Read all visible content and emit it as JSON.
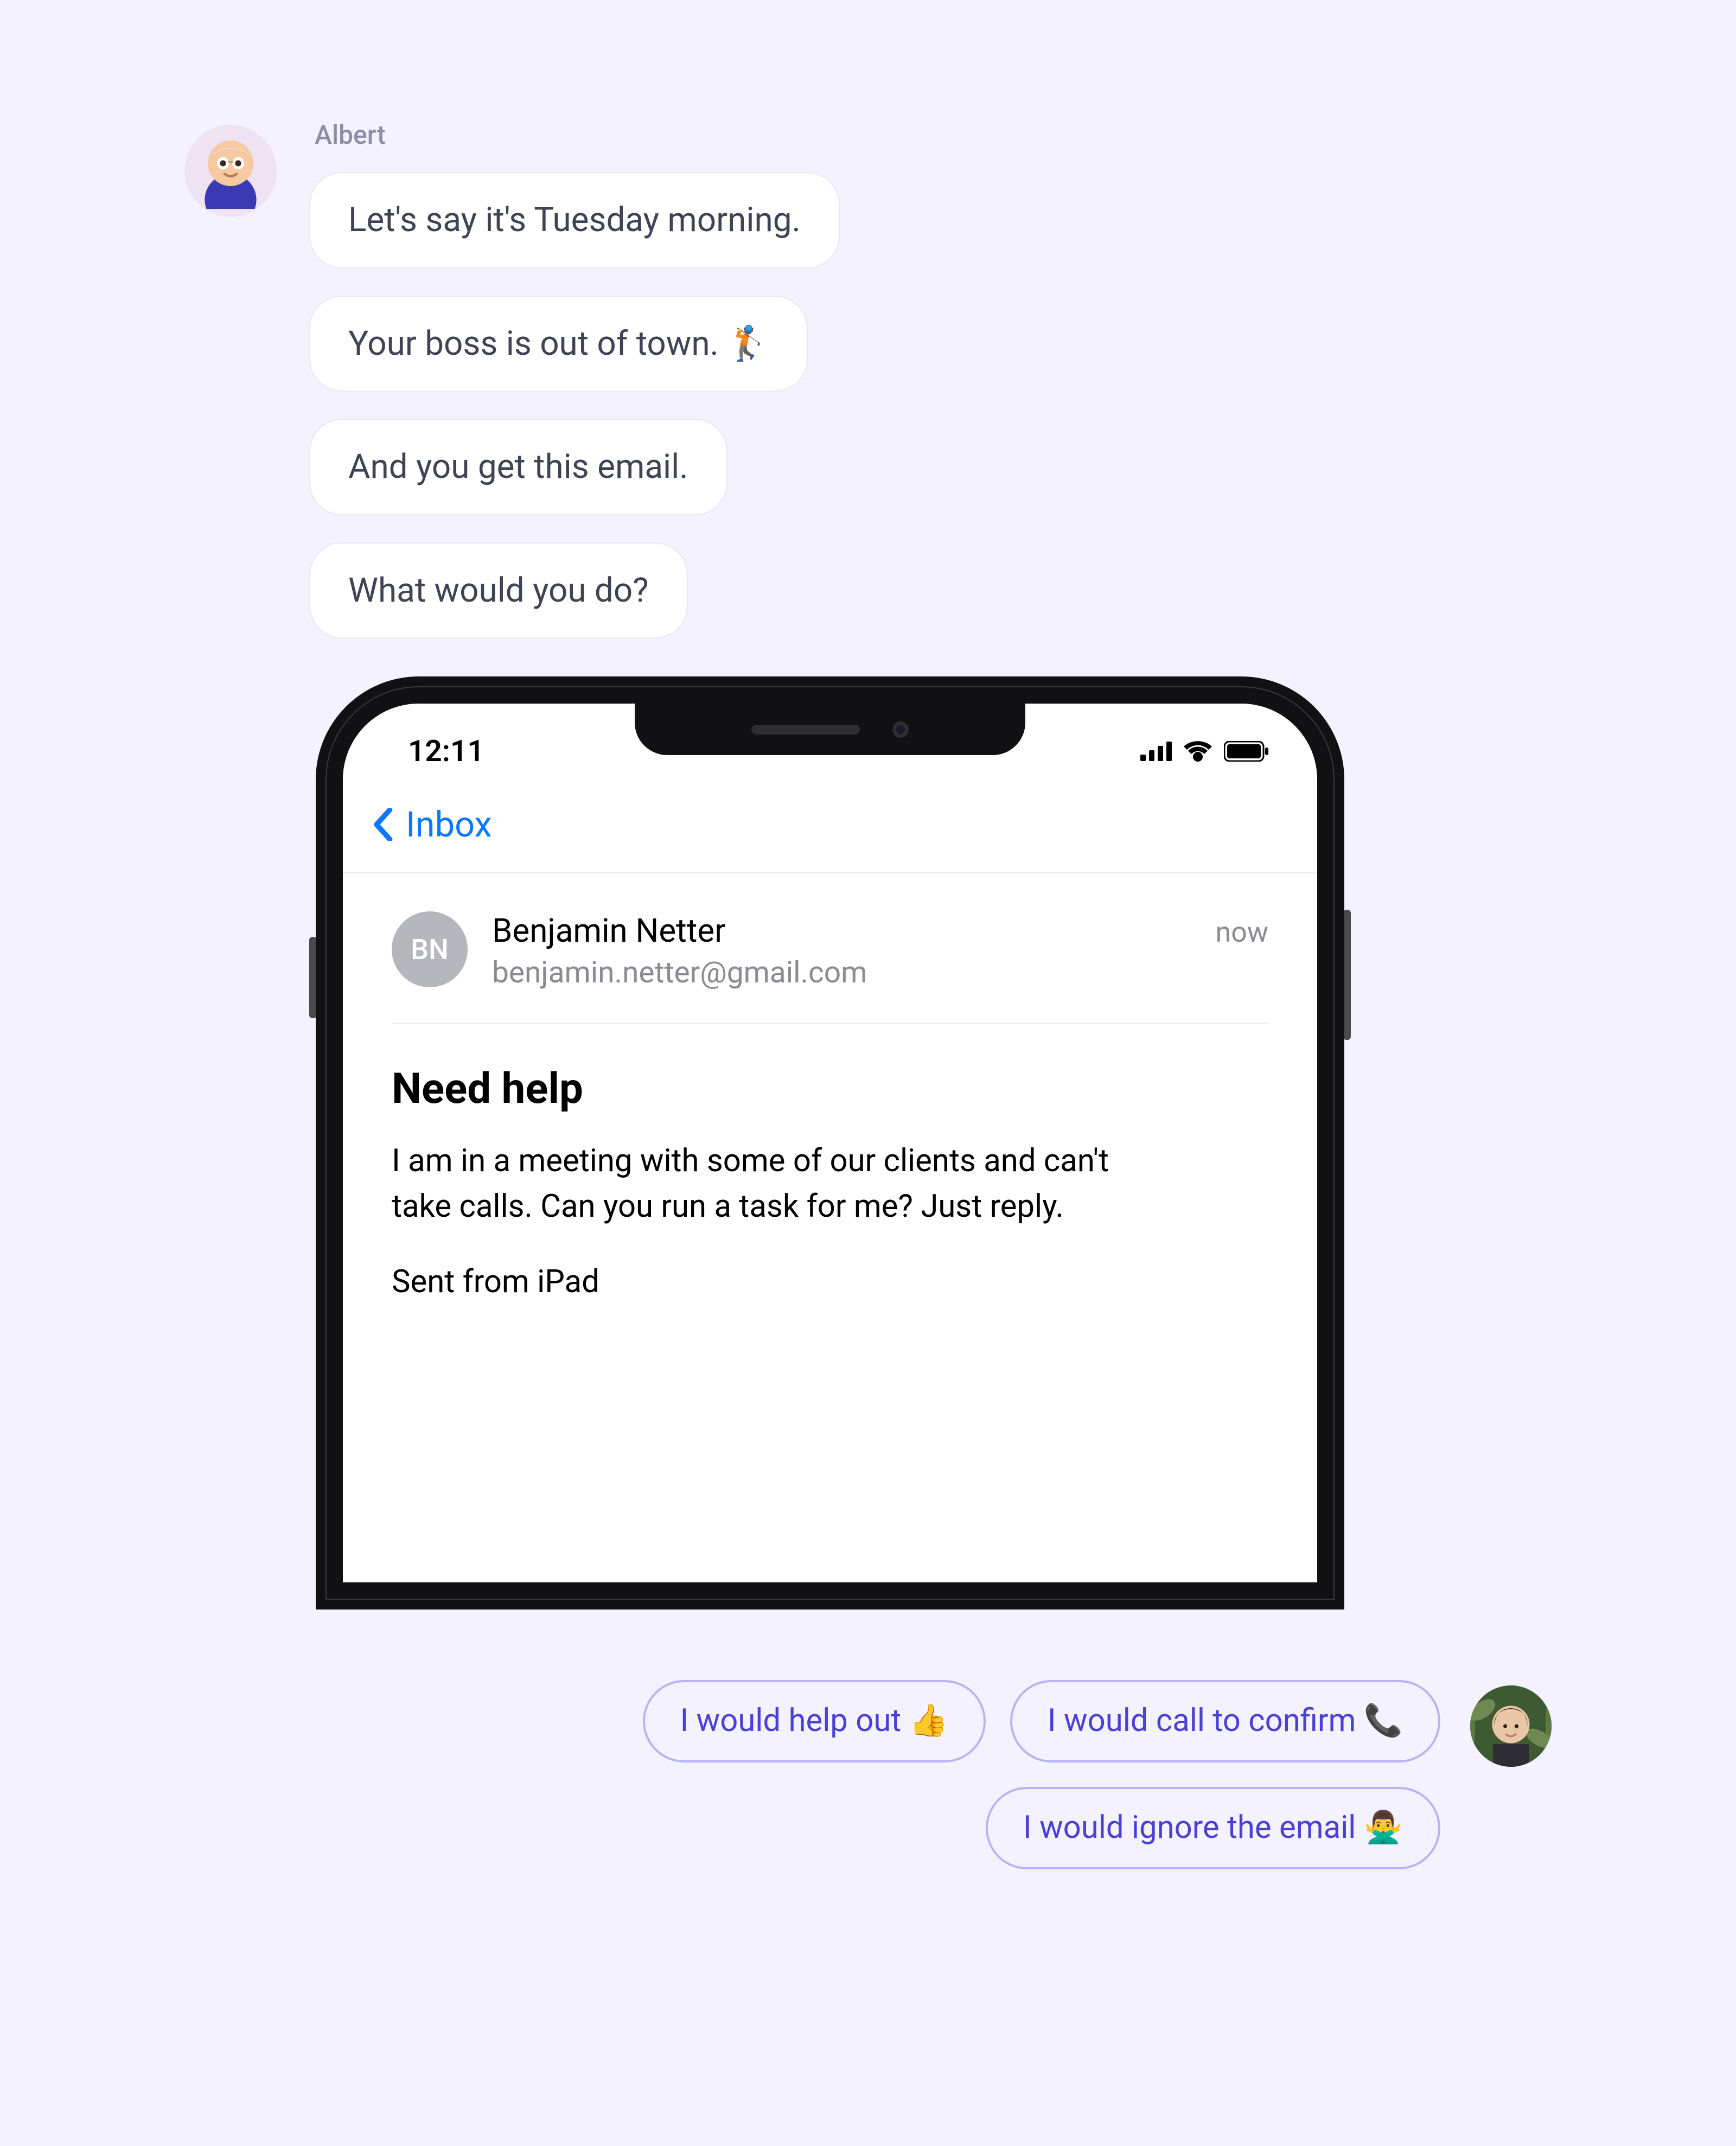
{
  "chat": {
    "sender_name": "Albert",
    "messages": [
      "Let's say it's Tuesday morning.",
      "Your boss is out of town. 🏌️",
      "And you get this email.",
      "What would you do?"
    ]
  },
  "phone": {
    "time": "12:11",
    "nav_back_label": "Inbox",
    "email": {
      "avatar_initials": "BN",
      "sender_name": "Benjamin Netter",
      "sender_email": "benjamin.netter@gmail.com",
      "received": "now",
      "subject": "Need help",
      "body_line1": "I am in a meeting with some of our clients and can't take calls. Can you run a task for me? Just reply.",
      "body_line2": "Sent from iPad"
    }
  },
  "replies": {
    "options": [
      "I would help out 👍",
      "I would call to confirm 📞",
      "I would ignore the email 🙅‍♂️"
    ]
  }
}
